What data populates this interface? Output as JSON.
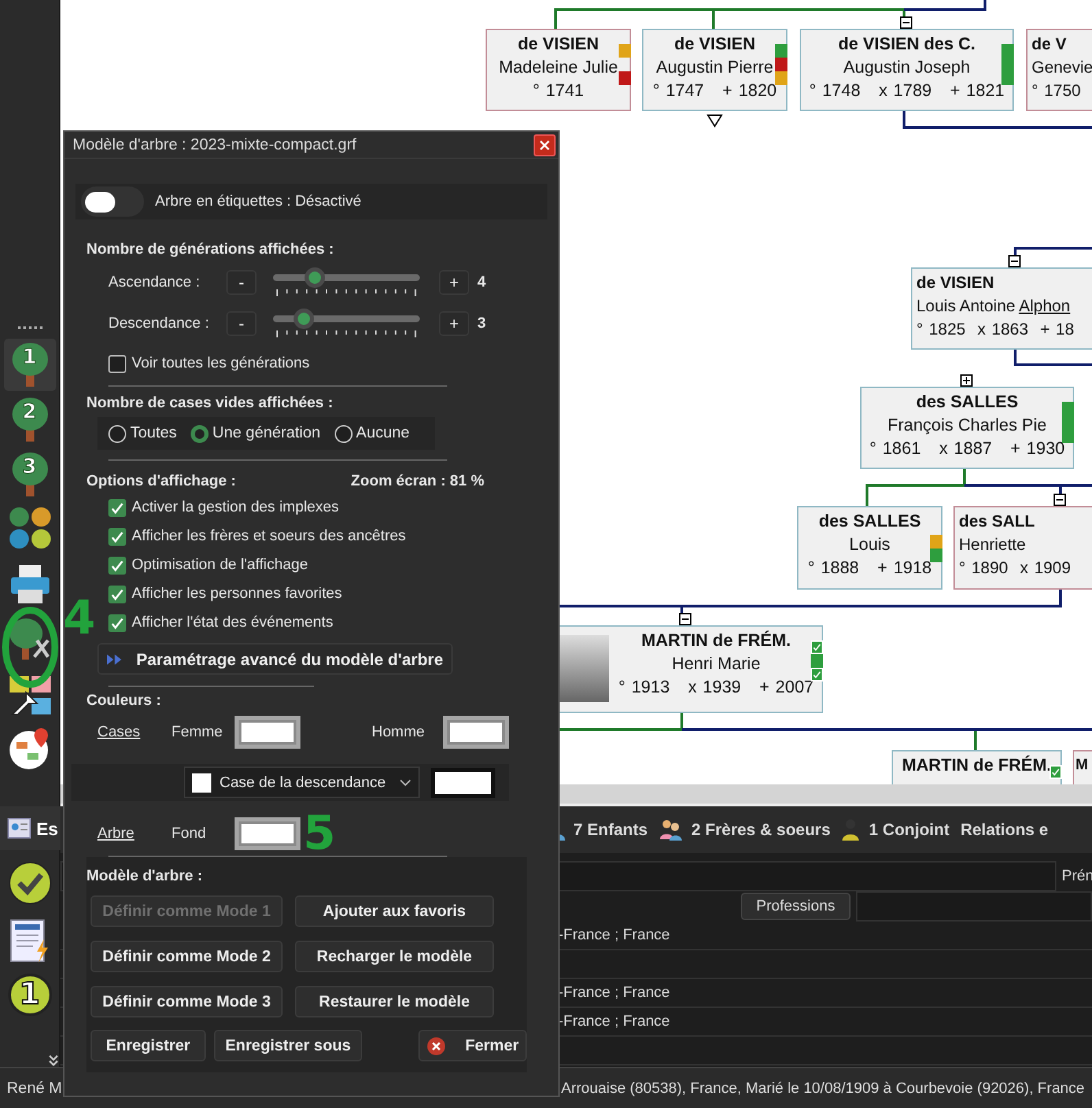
{
  "sidebar": {
    "tools": [
      {
        "kind": "tree",
        "label": "1",
        "selected": true
      },
      {
        "kind": "tree",
        "label": "2",
        "selected": false
      },
      {
        "kind": "tree",
        "label": "3",
        "selected": false
      },
      {
        "kind": "forest"
      },
      {
        "kind": "printer"
      },
      {
        "kind": "tree-tools"
      },
      {
        "kind": "colors"
      },
      {
        "kind": "map"
      }
    ],
    "tab": {
      "label": "Es"
    },
    "lower_tools": [
      {
        "kind": "check"
      },
      {
        "kind": "document"
      },
      {
        "kind": "badge",
        "label": "1"
      }
    ]
  },
  "tree": {
    "nodes": [
      {
        "female": true,
        "surname": "de VISIEN",
        "given": "Madeleine Julie",
        "dates": [
          "° 1741"
        ],
        "markers": [
          {
            "kind": "flag",
            "color": "#e0a418"
          },
          {
            "kind": "empty"
          },
          {
            "kind": "flag",
            "color": "#c01818"
          }
        ]
      },
      {
        "female": false,
        "surname": "de VISIEN",
        "given": "Augustin Pierre",
        "dates": [
          "° 1747",
          "+ 1820"
        ],
        "markers": [
          {
            "kind": "flag",
            "color": "#2e9e3e"
          },
          {
            "kind": "flag",
            "color": "#c01818"
          },
          {
            "kind": "flag",
            "color": "#e0a418"
          }
        ],
        "collapsed_below": true
      },
      {
        "female": false,
        "surname": "de VISIEN des C.",
        "given": "Augustin Joseph",
        "dates": [
          "° 1748",
          "x 1789",
          "+ 1821"
        ],
        "markers": [
          {
            "kind": "flag",
            "color": "#2e9e3e"
          },
          {
            "kind": "flag",
            "color": "#2e9e3e"
          },
          {
            "kind": "flag",
            "color": "#2e9e3e"
          }
        ],
        "expander": true,
        "expanded": true
      },
      {
        "female": true,
        "surname": "de V",
        "given": "Genevie",
        "dates": [
          "° 1750"
        ]
      },
      {
        "female": false,
        "surname": "de VISIEN",
        "given": "Louis Antoine",
        "link": "Alphon",
        "dates": [
          "° 1825",
          "x 1863",
          "+ 18"
        ],
        "expander": true,
        "expanded": true
      },
      {
        "female": false,
        "surname": "des SALLES",
        "given": "François Charles Pie",
        "dates": [
          "° 1861",
          "x 1887",
          "+ 1930"
        ],
        "markers": [
          {
            "kind": "flag",
            "color": "#2e9e3e"
          },
          {
            "kind": "flag",
            "color": "#2e9e3e"
          },
          {
            "kind": "flag",
            "color": "#2e9e3e"
          }
        ],
        "expander": true,
        "expanded": false
      },
      {
        "female": false,
        "surname": "des SALLES",
        "given": "Louis",
        "dates": [
          "° 1888",
          "+ 1918"
        ],
        "markers": [
          {
            "kind": "empty"
          },
          {
            "kind": "flag",
            "color": "#e0a418"
          },
          {
            "kind": "flag",
            "color": "#2e9e3e"
          }
        ]
      },
      {
        "female": true,
        "surname": "des SALL",
        "given": "Henriette",
        "dates": [
          "° 1890",
          "x 1909"
        ],
        "expander": true,
        "expanded": true
      },
      {
        "female": false,
        "surname": "MARTIN de FRÉM.",
        "given": "Henri Marie",
        "dates": [
          "° 1913",
          "x 1939",
          "+ 2007"
        ],
        "photo": true,
        "markers": [
          {
            "kind": "check",
            "color": "#2e9e3e"
          },
          {
            "kind": "flag",
            "color": "#2e9e3e"
          },
          {
            "kind": "check",
            "color": "#2e9e3e"
          }
        ],
        "expander": true,
        "expanded": true
      },
      {
        "female": false,
        "surname": "MARTIN de FRÉM.",
        "markers": [
          {
            "kind": "check",
            "color": "#2e9e3e"
          }
        ]
      },
      {
        "female": true,
        "surname": "M"
      }
    ]
  },
  "dialog": {
    "title": "Modèle d'arbre : 2023-mixte-compact.grf",
    "label_toggle": {
      "on": false,
      "text": "Arbre en étiquettes : Désactivé"
    },
    "generations": {
      "heading": "Nombre de générations affichées :",
      "sliders": [
        {
          "label": "Ascendance :",
          "minus": "-",
          "plus": "+",
          "level": 0.28,
          "value": "4"
        },
        {
          "label": "Descendance :",
          "minus": "-",
          "plus": "+",
          "level": 0.21,
          "value": "3"
        }
      ],
      "all": {
        "checked": false,
        "label": "Voir toutes les générations"
      }
    },
    "empty_boxes": {
      "heading": "Nombre de cases vides affichées :",
      "options": [
        {
          "label": "Toutes",
          "selected": false
        },
        {
          "label": "Une génération",
          "selected": true
        },
        {
          "label": "Aucune",
          "selected": false
        }
      ]
    },
    "display": {
      "heading": "Options d'affichage :",
      "zoom": "Zoom écran : 81 %",
      "options": [
        {
          "label": "Activer la gestion des implexes",
          "checked": true
        },
        {
          "label": "Afficher les frères et soeurs des ancêtres",
          "checked": true
        },
        {
          "label": "Optimisation de l'affichage",
          "checked": true
        },
        {
          "label": "Afficher les personnes favorites",
          "checked": true
        },
        {
          "label": "Afficher l'état des événements",
          "checked": true
        }
      ],
      "advanced": "Paramétrage avancé du modèle d'arbre"
    },
    "colors": {
      "heading": "Couleurs :",
      "cases": "Cases",
      "femme": "Femme",
      "homme": "Homme",
      "select": "Case de la descendance",
      "arbre": "Arbre",
      "fond": "Fond"
    },
    "model": {
      "heading": "Modèle d'arbre :",
      "buttons": [
        {
          "label": "Définir comme Mode 1",
          "disabled": true
        },
        {
          "label": "Ajouter aux favoris",
          "disabled": false
        },
        {
          "label": "Définir comme Mode 2",
          "disabled": false
        },
        {
          "label": "Recharger le modèle",
          "disabled": false
        },
        {
          "label": "Définir comme Mode 3",
          "disabled": false
        },
        {
          "label": "Restaurer le modèle",
          "disabled": false
        }
      ],
      "save": "Enregistrer",
      "save_as": "Enregistrer sous",
      "close": "Fermer"
    }
  },
  "annotations": [
    "4",
    "5"
  ],
  "bottom": {
    "tabs": [
      {
        "kind": "children",
        "label": "7 Enfants"
      },
      {
        "kind": "siblings",
        "label": "2 Frères & soeurs"
      },
      {
        "kind": "spouse",
        "label": "1 Conjoint"
      },
      {
        "kind": "plain",
        "label": "Relations e"
      }
    ],
    "field_label": "Prén",
    "professions": "Professions",
    "rows": [
      "-France ; France",
      "",
      "-France ; France",
      "-France ; France",
      ""
    ]
  },
  "status_bar": {
    "left": "René M",
    "right": "Arrouaise (80538), France, Marié le 10/08/1909 à Courbevoie (92026), France"
  }
}
